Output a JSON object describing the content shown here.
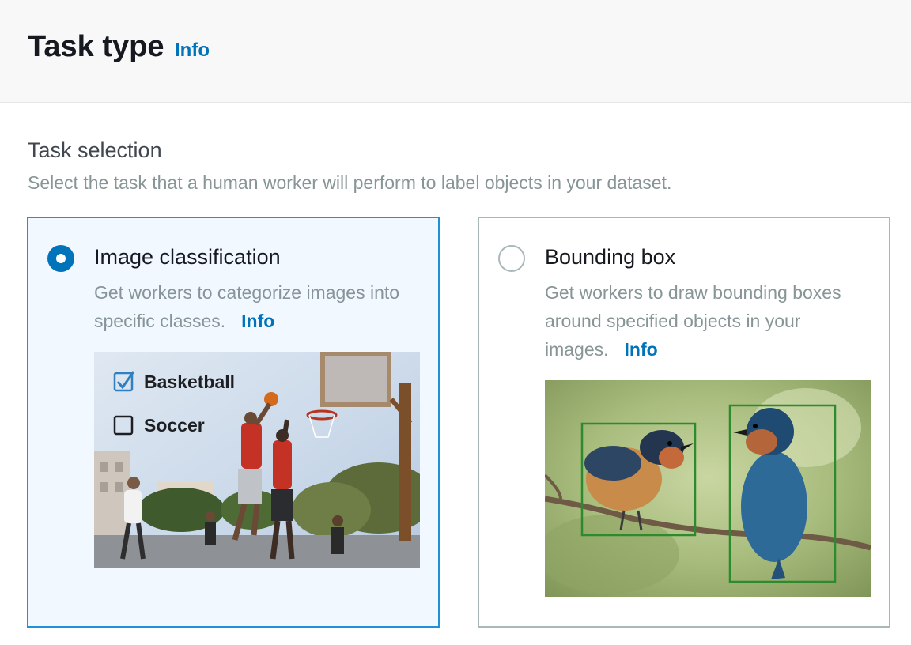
{
  "header": {
    "title": "Task type",
    "info": "Info"
  },
  "section": {
    "title": "Task selection",
    "description": "Select the task that a human worker will perform to label objects in your dataset."
  },
  "tiles": [
    {
      "title": "Image classification",
      "description": "Get workers to categorize images into specific classes.",
      "info": "Info",
      "selected": true,
      "image": {
        "labels": [
          {
            "text": "Basketball",
            "checked": true
          },
          {
            "text": "Soccer",
            "checked": false
          }
        ]
      }
    },
    {
      "title": "Bounding box",
      "description": "Get workers to draw bounding boxes around specified objects in your images.",
      "info": "Info",
      "selected": false
    }
  ],
  "colors": {
    "accent": "#0073bb",
    "selected_border": "#2191d5",
    "selected_bg": "#f1f8ff",
    "bbox": "#2d8a2d"
  }
}
